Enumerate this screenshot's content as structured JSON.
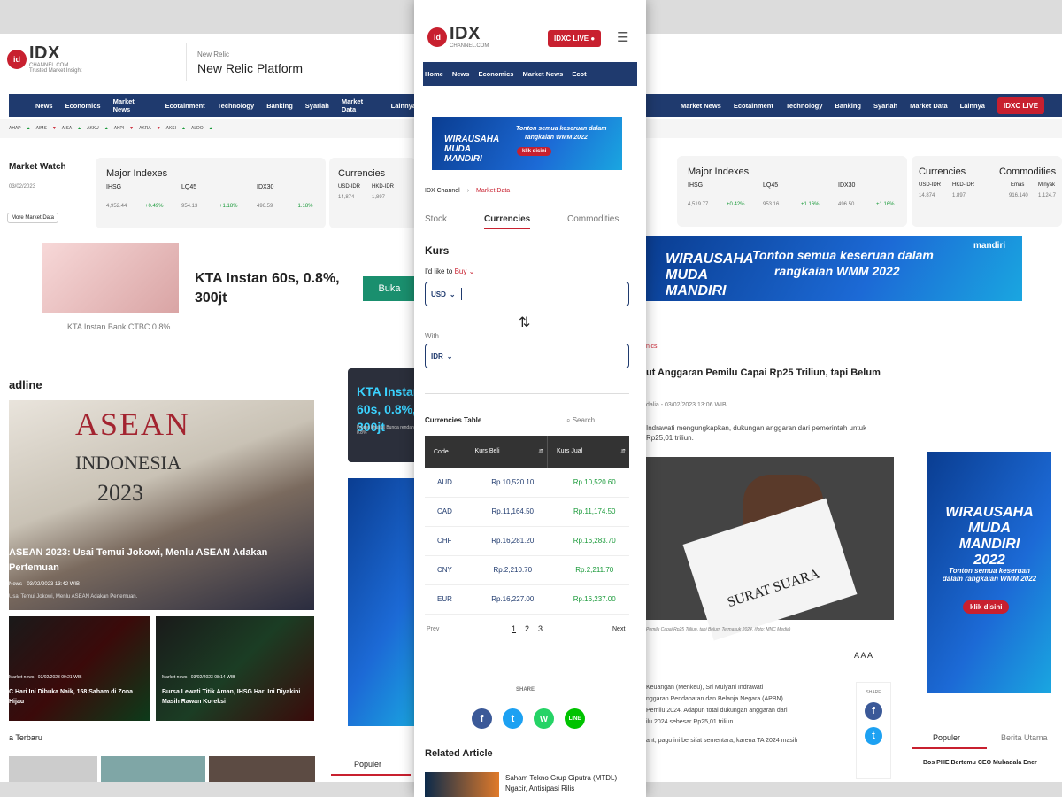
{
  "brand": {
    "logo_main": "IDX",
    "logo_sub": "CHANNEL.COM",
    "tagline": "Trusted Market Insight"
  },
  "live_label": "IDXC LIVE",
  "left": {
    "ad_label": "New Relic",
    "ad_title": "New Relic Platform",
    "nav": [
      "News",
      "Economics",
      "Market News",
      "Ecotainment",
      "Technology",
      "Banking",
      "Syariah",
      "Market Data",
      "Lainnya"
    ],
    "ticker": [
      {
        "s": "AHAP",
        "d": "u"
      },
      {
        "s": "AIMS",
        "d": "d"
      },
      {
        "s": "AISA",
        "d": "u"
      },
      {
        "s": "AKKU",
        "d": "u"
      },
      {
        "s": "AKPI",
        "d": "d"
      },
      {
        "s": "AKRA",
        "d": "d"
      },
      {
        "s": "AKSI",
        "d": "u"
      },
      {
        "s": "ALDO",
        "d": "u"
      }
    ],
    "market_watch": "Market Watch",
    "mw_date": "03/02/2023",
    "mw_more": "More Market Data",
    "major_indexes": "Major Indexes",
    "indexes": [
      {
        "name": "IHSG",
        "val": "4,952.44",
        "chg": "+0.49%"
      },
      {
        "name": "LQ45",
        "val": "954.13",
        "chg": "+1.18%"
      },
      {
        "name": "IDX30",
        "val": "496.59",
        "chg": "+1.18%"
      }
    ],
    "currencies": "Currencies",
    "cur_pairs": [
      "USD-IDR",
      "HKD-IDR"
    ],
    "cur_vals": [
      "14,874",
      "1,897"
    ],
    "ad2_title": "KTA Instan 60s, 0.8%, 300jt",
    "ad2_btn": "Buka",
    "ad2_src": "KTA Instan Bank CTBC 0.8%",
    "headline": "adline",
    "main_title": "ASEAN 2023: Usai Temui Jokowi, Menlu ASEAN Adakan Pertemuan",
    "main_meta": "News - 03/02/2023 13:42 WIB",
    "main_sub": "Usai Temui Jokowi, Menlu ASEAN Adakan Pertemuan.",
    "img_text1": "ASEAN",
    "img_text2": "INDONESIA",
    "img_text3": "2023",
    "sub1_meta": "Market news - 03/02/2023 09:21 WIB",
    "sub1_title": "C Hari Ini Dibuka Naik, 158 Saham di Zona Hijau",
    "sub2_meta": "Market news - 03/02/2023 08:14 WIB",
    "sub2_title": "Bursa Lewati Titik Aman, IHSG Hari Ini Diyakini Masih Rawan Koreksi",
    "terbaru": "a Terbaru",
    "populer": "Populer",
    "side_ad_title": "KTA Instan 60s, 0.8%, 300jt",
    "side_ad_small": "Promo khusus Bunga rendah 0.8%"
  },
  "mid": {
    "ad_line1": "Tonton semua keseruan dalam",
    "ad_line2": "rangkaian WMM 2022",
    "ad_brand": "WIRAUSAHA MUDA MANDIRI",
    "ad_btn": "klik disini",
    "breadcrumb": [
      "IDX Channel",
      "Market Data"
    ],
    "tabs": [
      "Stock",
      "Currencies",
      "Commodities"
    ],
    "kurs": "Kurs",
    "like_to": "I'd like to",
    "buy": "Buy",
    "from_cur": "USD",
    "with": "With",
    "to_cur": "IDR",
    "swap_icon": "swap-vertical-icon",
    "table_title": "Currencies Table",
    "search": "Search",
    "headers": [
      "Code",
      "Kurs Beli",
      "Kurs Jual"
    ],
    "rows": [
      {
        "code": "AUD",
        "beli": "Rp.10,520.10",
        "jual": "Rp.10,520.60"
      },
      {
        "code": "CAD",
        "beli": "Rp.11,164.50",
        "jual": "Rp.11,174.50"
      },
      {
        "code": "CHF",
        "beli": "Rp.16,281.20",
        "jual": "Rp.16,283.70"
      },
      {
        "code": "CNY",
        "beli": "Rp.2,210.70",
        "jual": "Rp.2,211.70"
      },
      {
        "code": "EUR",
        "beli": "Rp.16,227.00",
        "jual": "Rp.16,237.00"
      }
    ],
    "prev": "Prev",
    "next": "Next",
    "pages": [
      "1",
      "2",
      "3"
    ],
    "share": "SHARE",
    "related": "Related Article",
    "related_title": "Saham Tekno Grup Ciputra (MTDL) Ngacir, Antisipasi Rilis"
  },
  "right": {
    "nav": [
      "Market News",
      "Ecotainment",
      "Technology",
      "Banking",
      "Syariah",
      "Market Data",
      "Lainnya"
    ],
    "major_indexes": "Major Indexes",
    "indexes": [
      {
        "name": "IHSG",
        "val": "4,519.77",
        "chg": "+0.42%"
      },
      {
        "name": "LQ45",
        "val": "953.16",
        "chg": "+1.16%"
      },
      {
        "name": "IDX30",
        "val": "496.50",
        "chg": "+1.16%"
      }
    ],
    "currencies": "Currencies",
    "commodities": "Commodities",
    "cur_pairs": [
      "USD-IDR",
      "HKD-IDR"
    ],
    "cur_vals": [
      "14,874",
      "1,897"
    ],
    "com_names": [
      "Emas",
      "Minyak"
    ],
    "com_vals": [
      "916.140",
      "1,124.7"
    ],
    "ad_line1": "Tonton semua keseruan dalam",
    "ad_line2": "rangkaian WMM 2022",
    "ad_brand": "WIRAUSAHA MUDA MANDIRI",
    "ad_bank": "mandiri",
    "section": "nics",
    "title": "ut Anggaran Pemilu Capai Rp25 Triliun, tapi Belum",
    "meta": "dalia - 03/02/2023 13:06 WIB",
    "lead": "Indrawati mengungkapkan, dukungan anggaran dari pemerintah untuk Rp25,01 triliun.",
    "img_text": "SURAT SUARA",
    "img_caption": "Pemilu Capai Rp25 Triliun, tapi Belum Termasuk 2024. (foto: MNC Media)",
    "font_sizes": "A A A",
    "body1": "Keuangan (Menkeu), Sri Mulyani Indrawati",
    "body2": "nggaran Pendapatan dan Belanja Negara (APBN)",
    "body3": "Pemilu 2024. Adapun total dukungan anggaran dari",
    "body4": "ilu 2024 sebesar Rp25,01 triliun.",
    "body5": "ant, pagu ini bersifat sementara, karena TA 2024 masih",
    "share": "SHARE",
    "tab_populer": "Populer",
    "tab_berita": "Berita Utama",
    "pop_item": "Bos PHE Bertemu CEO Mubadala Ener",
    "side_ad_brand": "WIRAUSAHA MUDA MANDIRI 2022",
    "side_ad_text": "Tonton semua keseruan dalam rangkaian WMM 2022",
    "side_ad_btn": "klik disini"
  }
}
